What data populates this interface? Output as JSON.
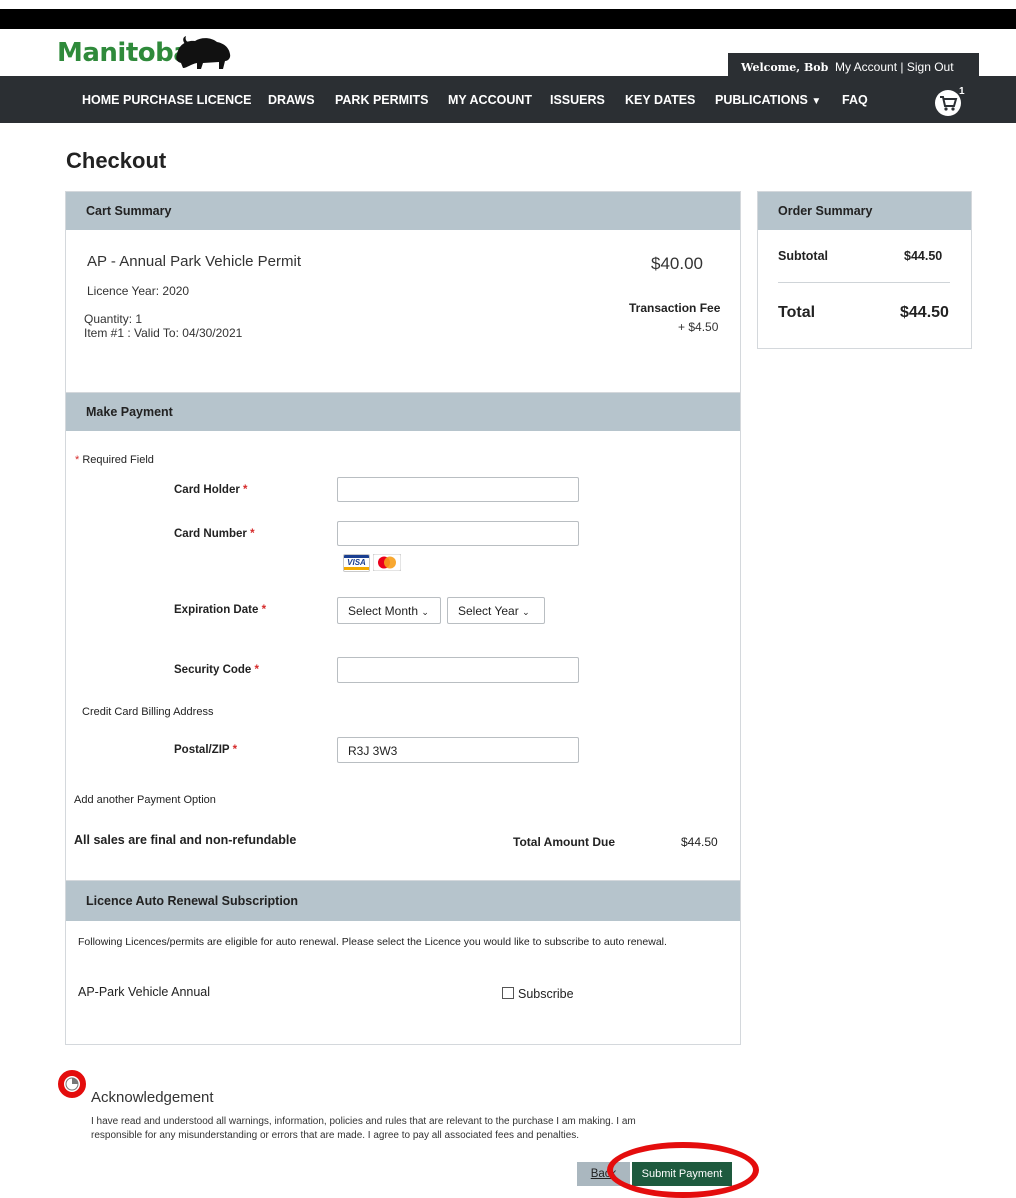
{
  "brand": {
    "logo_text": "Manitoba"
  },
  "header": {
    "welcome": "Welcome, Bob",
    "my_account": "My Account",
    "separator": "|",
    "sign_out": "Sign Out",
    "cart_count": "1"
  },
  "nav": [
    {
      "label": "HOME"
    },
    {
      "label": "PURCHASE LICENCE"
    },
    {
      "label": "DRAWS"
    },
    {
      "label": "PARK PERMITS"
    },
    {
      "label": "MY ACCOUNT"
    },
    {
      "label": "ISSUERS"
    },
    {
      "label": "KEY DATES"
    },
    {
      "label": "PUBLICATIONS"
    },
    {
      "label": "FAQ"
    }
  ],
  "page": {
    "title": "Checkout"
  },
  "cart_summary": {
    "heading": "Cart Summary",
    "item_name": "AP - Annual Park Vehicle Permit",
    "item_price": "$40.00",
    "licence_year": "Licence Year: 2020",
    "quantity": "Quantity: 1",
    "valid_to": "Item #1 : Valid To: 04/30/2021",
    "fee_label": "Transaction Fee",
    "fee_value": "+ $4.50"
  },
  "order_summary": {
    "heading": "Order Summary",
    "subtotal_label": "Subtotal",
    "subtotal_value": "$44.50",
    "total_label": "Total",
    "total_value": "$44.50"
  },
  "payment": {
    "heading": "Make Payment",
    "required_note": "Required Field",
    "required_mark": "*",
    "card_holder_label": "Card Holder",
    "card_holder_value": "",
    "card_number_label": "Card Number",
    "card_number_value": "",
    "card_logos": [
      "visa-icon",
      "mastercard-icon"
    ],
    "visa_text": "VISA",
    "expiration_label": "Expiration Date",
    "month_select": "Select Month",
    "year_select": "Select Year",
    "security_label": "Security Code",
    "security_value": "",
    "billing_heading": "Credit Card Billing Address",
    "postal_label": "Postal/ZIP",
    "postal_value": "R3J 3W3",
    "add_payment_link": "Add another Payment Option",
    "final_note": "All sales are final and non-refundable",
    "total_due_label": "Total Amount Due",
    "total_due_value": "$44.50"
  },
  "renewal": {
    "heading": "Licence Auto Renewal Subscription",
    "description": "Following Licences/permits are eligible for auto renewal. Please select the Licence you would like to subscribe to auto renewal.",
    "item_label": "AP-Park Vehicle Annual",
    "subscribe_label": "Subscribe"
  },
  "acknowledgement": {
    "heading": "Acknowledgement",
    "line1": "I have read and understood all warnings, information, policies and rules that are relevant to the purchase I am making. I am",
    "line2": "responsible for any misunderstanding or errors that are made. I agree to pay all associated fees and penalties."
  },
  "actions": {
    "back_label": "Back",
    "submit_label": "Submit Payment"
  },
  "colors": {
    "nav_bg": "#2b2f33",
    "panel_header": "#b6c4cc",
    "brand_green": "#2f8a3b",
    "submit_green": "#1e5a3e",
    "annotation_red": "#e40d0d"
  }
}
